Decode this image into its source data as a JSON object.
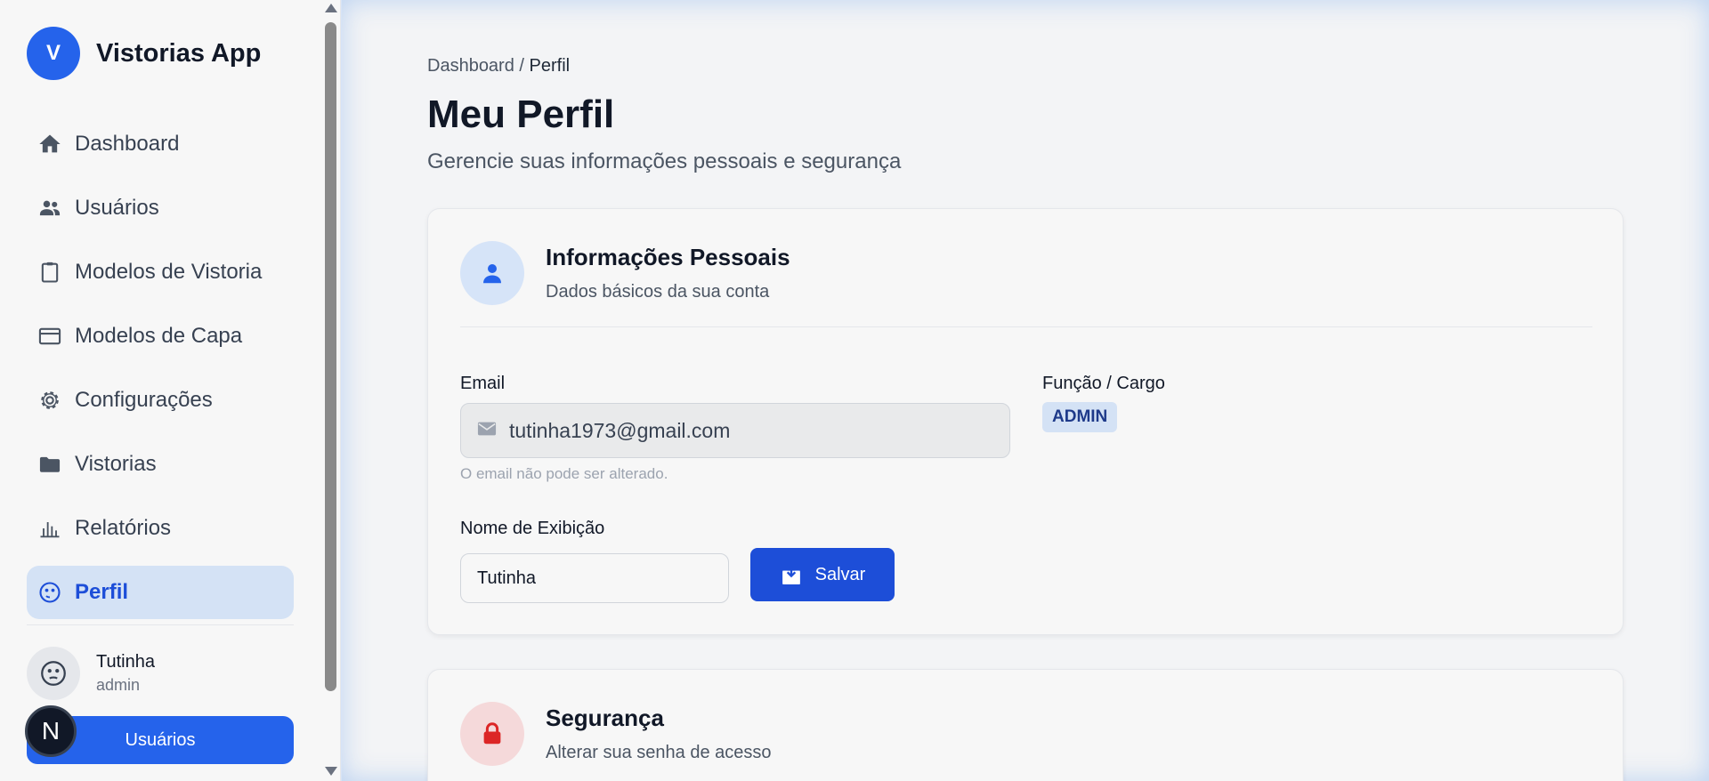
{
  "brand": {
    "logo_letter": "V",
    "name": "Vistorias App"
  },
  "sidebar": {
    "items": [
      {
        "label": "Dashboard",
        "icon": "home-icon"
      },
      {
        "label": "Usuários",
        "icon": "users-icon"
      },
      {
        "label": "Modelos de Vistoria",
        "icon": "clipboard-icon"
      },
      {
        "label": "Modelos de Capa",
        "icon": "card-icon"
      },
      {
        "label": "Configurações",
        "icon": "gear-icon"
      },
      {
        "label": "Vistorias",
        "icon": "folder-icon"
      },
      {
        "label": "Relatórios",
        "icon": "bar-chart-icon"
      },
      {
        "label": "Perfil",
        "icon": "face-icon",
        "active": true
      }
    ],
    "user": {
      "name": "Tutinha",
      "role": "admin"
    },
    "bottom_button": "Usuários",
    "badge_letter": "N"
  },
  "breadcrumb": {
    "root": "Dashboard",
    "separator": "/",
    "current": "Perfil"
  },
  "page": {
    "title": "Meu Perfil",
    "subtitle": "Gerencie suas informações pessoais e segurança"
  },
  "personal": {
    "title": "Informações Pessoais",
    "subtitle": "Dados básicos da sua conta",
    "email_label": "Email",
    "email_value": "tutinha1973@gmail.com",
    "email_hint": "O email não pode ser alterado.",
    "role_label": "Função / Cargo",
    "role_value": "ADMIN",
    "display_name_label": "Nome de Exibição",
    "display_name_value": "Tutinha",
    "save_label": "Salvar"
  },
  "security": {
    "title": "Segurança",
    "subtitle": "Alterar sua senha de acesso"
  },
  "colors": {
    "primary": "#2563eb",
    "active_bg": "#d4e2f5",
    "danger": "#dc2626"
  }
}
